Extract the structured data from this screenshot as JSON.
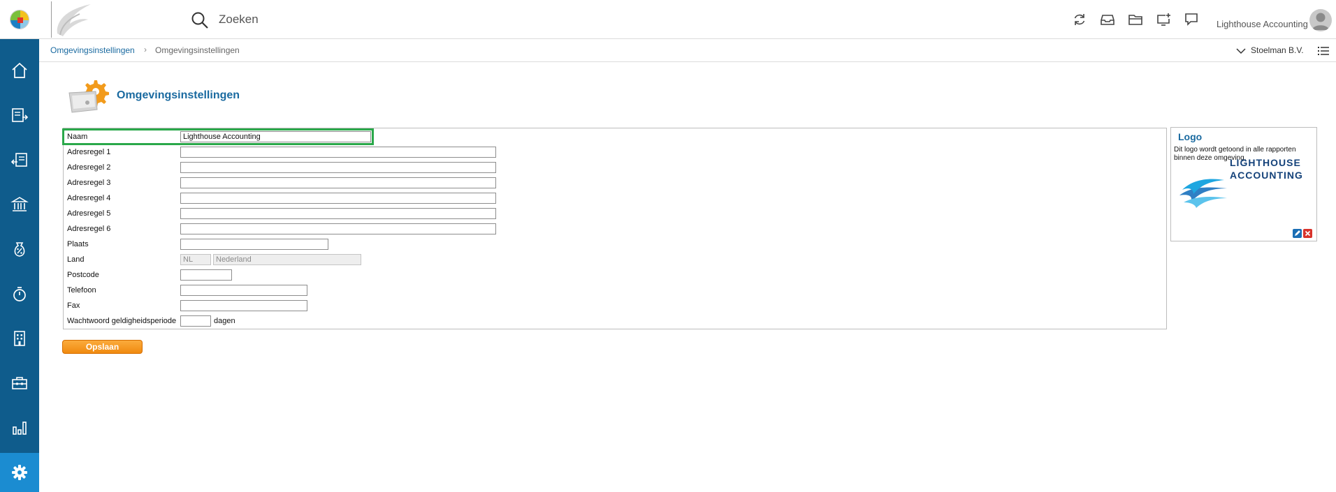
{
  "search": {
    "placeholder": "Zoeken"
  },
  "header": {
    "user_name": "Lighthouse Accounting",
    "toolbar_icons": [
      "refresh-icon",
      "inbox-icon",
      "folder-icon",
      "screen-add-icon",
      "chat-icon"
    ]
  },
  "sidebar": {
    "items": [
      "home-icon",
      "invoice-out-icon",
      "invoice-in-icon",
      "bank-icon",
      "tax-icon",
      "timer-icon",
      "company-icon",
      "toolbox-icon",
      "reports-icon",
      "settings-icon"
    ],
    "active": "settings-icon"
  },
  "breadcrumb": {
    "items": [
      "Omgevingsinstellingen",
      "Omgevingsinstellingen"
    ],
    "company": "Stoelman B.V."
  },
  "page": {
    "title": "Omgevingsinstellingen"
  },
  "form": {
    "naam": {
      "label": "Naam",
      "value": "Lighthouse Accounting"
    },
    "adresregel_1": {
      "label": "Adresregel 1",
      "value": ""
    },
    "adresregel_2": {
      "label": "Adresregel 2",
      "value": ""
    },
    "adresregel_3": {
      "label": "Adresregel 3",
      "value": ""
    },
    "adresregel_4": {
      "label": "Adresregel 4",
      "value": ""
    },
    "adresregel_5": {
      "label": "Adresregel 5",
      "value": ""
    },
    "adresregel_6": {
      "label": "Adresregel 6",
      "value": ""
    },
    "plaats": {
      "label": "Plaats",
      "value": ""
    },
    "land": {
      "label": "Land",
      "code": "NL",
      "name": "Nederland"
    },
    "postcode": {
      "label": "Postcode",
      "value": ""
    },
    "telefoon": {
      "label": "Telefoon",
      "value": ""
    },
    "fax": {
      "label": "Fax",
      "value": ""
    },
    "wachtwoord": {
      "label": "Wachtwoord geldigheidsperiode",
      "value": "",
      "suffix": "dagen"
    },
    "save_label": "Opslaan"
  },
  "logo_panel": {
    "title": "Logo",
    "description": "Dit logo wordt getoond in alle rapporten binnen deze omgeving.",
    "logo_text_1": "LIGHTHOUSE",
    "logo_text_2": "ACCOUNTING"
  },
  "colors": {
    "sidebar": "#0f5c8c",
    "sidebar_active": "#1b8cd1",
    "link": "#1a6aa0",
    "highlight": "#2aa84a",
    "save_button": "#f08a0f"
  }
}
